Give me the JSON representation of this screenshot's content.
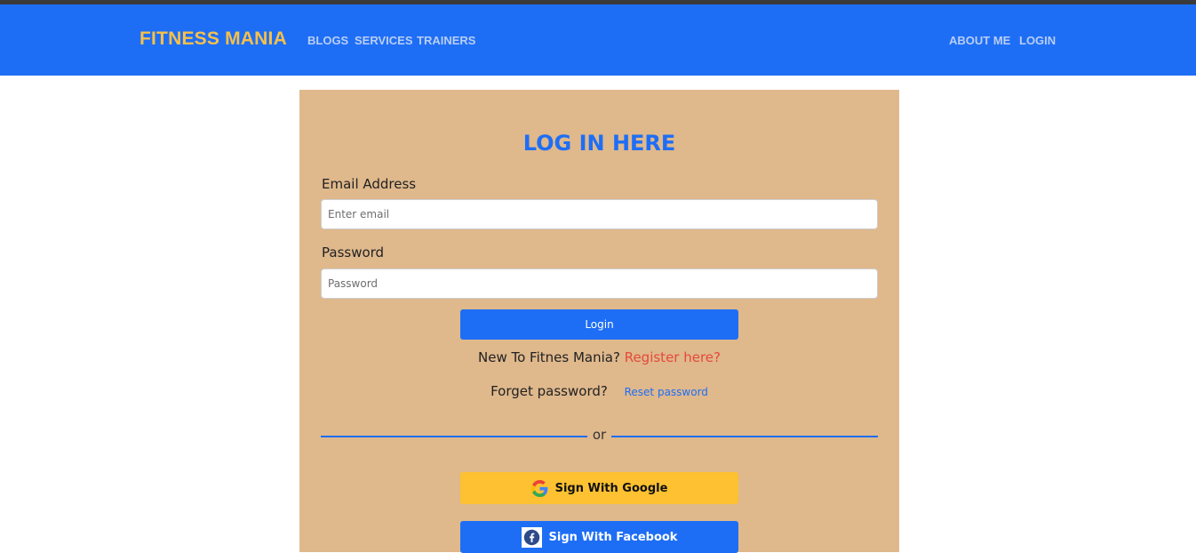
{
  "nav": {
    "brand": "FITNESS MANIA",
    "links": [
      "BLOGS",
      "SERVICES",
      "TRAINERS"
    ],
    "right_links": [
      "ABOUT ME",
      "LOGIN"
    ]
  },
  "form": {
    "title": "LOG IN HERE",
    "email_label": "Email Address",
    "email_placeholder": "Enter email",
    "password_label": "Password",
    "password_placeholder": "Password",
    "login_button": "Login",
    "new_user_text": "New To Fitnes Mania?",
    "register_link": "Register here?",
    "forgot_text": "Forget password?",
    "reset_link": "Reset password",
    "divider_text": "or",
    "google_button": "Sign With Google",
    "facebook_button": "Sign With Facebook"
  },
  "colors": {
    "navbar": "#1e6ef5",
    "brand": "#f7c04a",
    "card": "#dfb88c",
    "google_button": "#fdc131",
    "register_link": "#e44a3a"
  },
  "icons": [
    "google-icon",
    "facebook-icon"
  ]
}
